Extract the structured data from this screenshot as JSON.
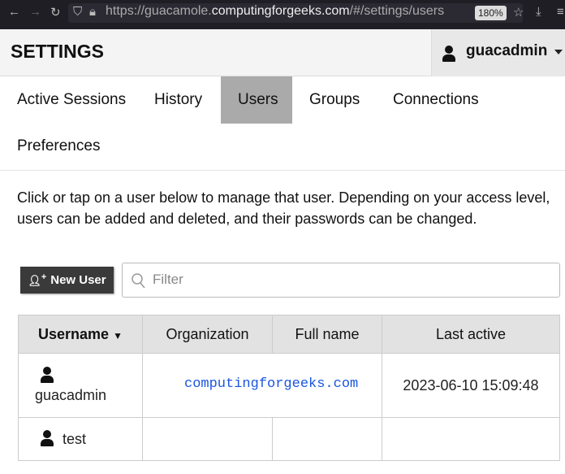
{
  "browser": {
    "url_prefix": "https://guacamole.",
    "url_domain": "computingforgeeks.com",
    "url_suffix": "/#/settings/users",
    "zoom": "180%"
  },
  "header": {
    "title": "SETTINGS",
    "username": "guacadmin"
  },
  "tabs": [
    "Active Sessions",
    "History",
    "Users",
    "Groups",
    "Connections",
    "Preferences"
  ],
  "active_tab": "Users",
  "description": "Click or tap on a user below to manage that user. Depending on your access level, users can be added and deleted, and their passwords can be changed.",
  "toolbar": {
    "new_user": "New User",
    "filter_placeholder": "Filter"
  },
  "table": {
    "headers": [
      "Username",
      "Organization",
      "Full name",
      "Last active"
    ],
    "rows": [
      {
        "username": "guacadmin",
        "organization": "computingforgeeks.com",
        "full_name": "",
        "last_active": "2023-06-10 15:09:48"
      },
      {
        "username": "test",
        "organization": "",
        "full_name": "",
        "last_active": ""
      }
    ]
  }
}
